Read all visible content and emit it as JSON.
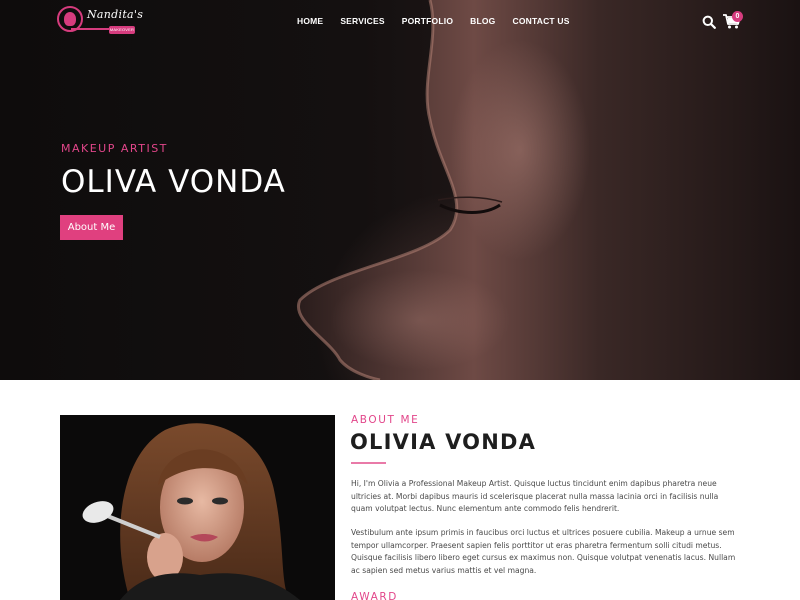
{
  "brand": {
    "name": "Nandita's",
    "tagline": "MAKEOVER"
  },
  "nav": {
    "items": [
      {
        "label": "HOME"
      },
      {
        "label": "SERVICES"
      },
      {
        "label": "PORTFOLIO"
      },
      {
        "label": "BLOG"
      },
      {
        "label": "CONTACT US"
      }
    ]
  },
  "cart": {
    "count": "0"
  },
  "hero": {
    "subtitle": "MAKEUP ARTIST",
    "title": "OLIVA VONDA",
    "button_label": "About Me"
  },
  "about": {
    "subtitle": "ABOUT ME",
    "title": "OLIVIA VONDA",
    "paragraph1": "Hi, I'm Olivia a Professional Makeup Artist. Quisque luctus tincidunt enim dapibus pharetra neue ultricies at. Morbi dapibus mauris id scelerisque placerat nulla massa lacinia orci in facilisis nulla quam volutpat lectus. Nunc elementum ante commodo felis hendrerit.",
    "paragraph2": "Vestibulum ante ipsum primis in faucibus orci luctus et ultrices posuere cubilia. Makeup a urnue sem tempor ullamcorper. Praesent sapien felis porttitor ut eras pharetra fermentum solli citudi metus. Quisque facilisis libero libero eget cursus ex maximus non. Quisque volutpat venenatis lacus. Nullam ac sapien sed metus varius mattis et vel magna.",
    "award_heading": "AWARD"
  },
  "colors": {
    "accent": "#e0407f",
    "hero_bg": "#0e0b0b",
    "heading": "#1e1e1e"
  }
}
